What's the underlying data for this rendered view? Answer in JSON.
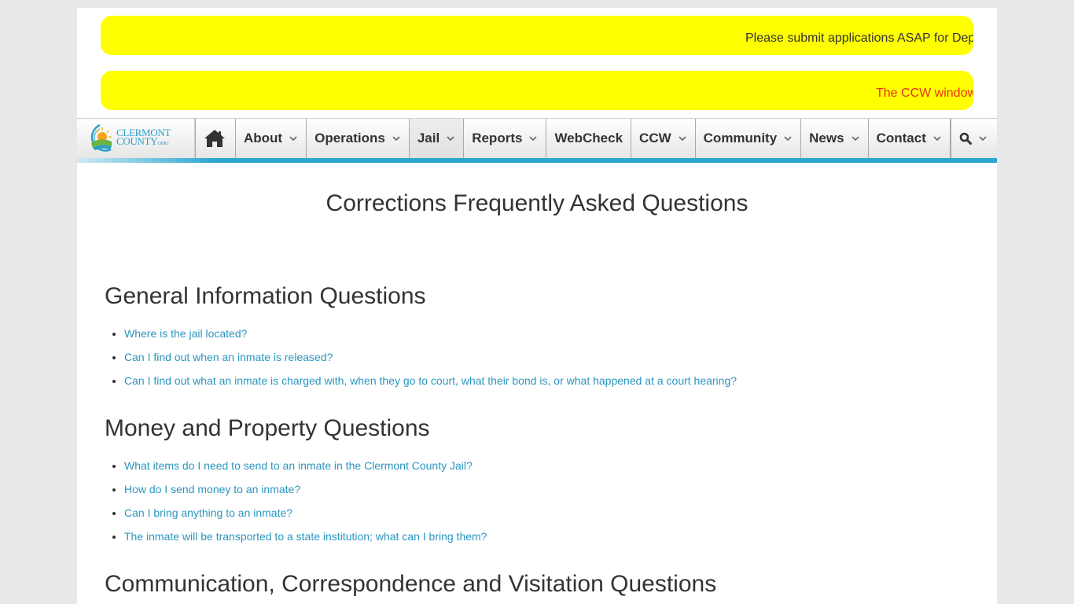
{
  "alerts": [
    {
      "text": "Please submit applications ASAP for Dep",
      "color": "#333333"
    },
    {
      "text": "The CCW window",
      "color": "#e8311a"
    }
  ],
  "logo": {
    "line1": "CLERMONT",
    "line2": "COUNTY",
    "suffix": "OHIO"
  },
  "nav": {
    "home_icon": "home-icon",
    "items": [
      {
        "label": "About",
        "dropdown": true
      },
      {
        "label": "Operations",
        "dropdown": true
      },
      {
        "label": "Jail",
        "dropdown": true,
        "active": true
      },
      {
        "label": "Reports",
        "dropdown": true
      },
      {
        "label": "WebCheck",
        "dropdown": false
      },
      {
        "label": "CCW",
        "dropdown": true
      },
      {
        "label": "Community",
        "dropdown": true
      },
      {
        "label": "News",
        "dropdown": true
      },
      {
        "label": "Contact",
        "dropdown": true
      }
    ],
    "search_icon": "search-icon",
    "accent_color": "#2aa6cf"
  },
  "main": {
    "title": "Corrections Frequently Asked Questions",
    "sections": [
      {
        "heading": "General Information Questions",
        "questions": [
          "Where is the jail located?",
          "Can I find out when an inmate is released?",
          "Can I find out what an inmate is charged with, when they go to court, what their bond is, or what happened at a court hearing?"
        ]
      },
      {
        "heading": "Money and Property Questions",
        "questions": [
          "What items do I need to send to an inmate in the Clermont County Jail?",
          "How do I send money to an inmate?",
          "Can I bring anything to an inmate?",
          "The inmate will be transported to a state institution; what can I bring them?"
        ]
      },
      {
        "heading": "Communication, Correspondence and Visitation Questions",
        "questions": []
      }
    ],
    "link_color": "#2a96bf"
  }
}
